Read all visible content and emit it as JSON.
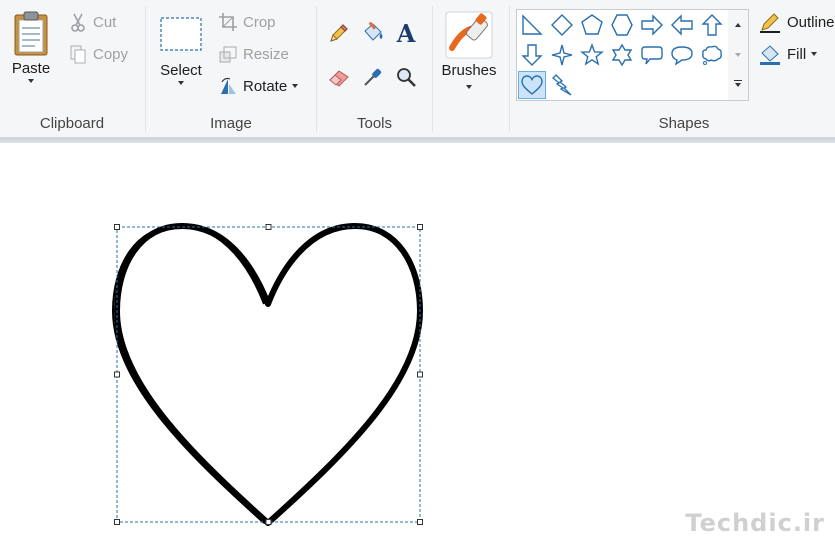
{
  "ribbon": {
    "clipboard": {
      "group_label": "Clipboard",
      "paste_label": "Paste",
      "cut_label": "Cut",
      "copy_label": "Copy"
    },
    "image": {
      "group_label": "Image",
      "select_label": "Select",
      "crop_label": "Crop",
      "resize_label": "Resize",
      "rotate_label": "Rotate"
    },
    "tools": {
      "group_label": "Tools",
      "items": [
        "pencil-icon",
        "fill-bucket-icon",
        "text-icon",
        "eraser-icon",
        "color-picker-icon",
        "magnifier-icon"
      ],
      "text_glyph": "A"
    },
    "brushes": {
      "label": "Brushes"
    },
    "shapes": {
      "group_label": "Shapes",
      "outline_label": "Outline",
      "fill_label": "Fill",
      "selected_shape": "heart",
      "items": [
        "right-triangle",
        "diamond",
        "pentagon",
        "hexagon",
        "arrow-right",
        "arrow-left",
        "arrow-up",
        "arrow-down",
        "four-point-star",
        "five-point-star",
        "six-point-star",
        "rounded-callout",
        "oval-callout",
        "cloud-callout",
        "heart",
        "lightning"
      ]
    }
  },
  "canvas": {
    "shape": "heart",
    "selection": "dashed-box-with-handles"
  },
  "watermark": "Techdic.ir",
  "colors": {
    "accent": "#2b6cb0",
    "ribbon_bg": "#f5f6f7",
    "selection_border": "#2a6fb0",
    "shape_stroke": "#000000"
  }
}
